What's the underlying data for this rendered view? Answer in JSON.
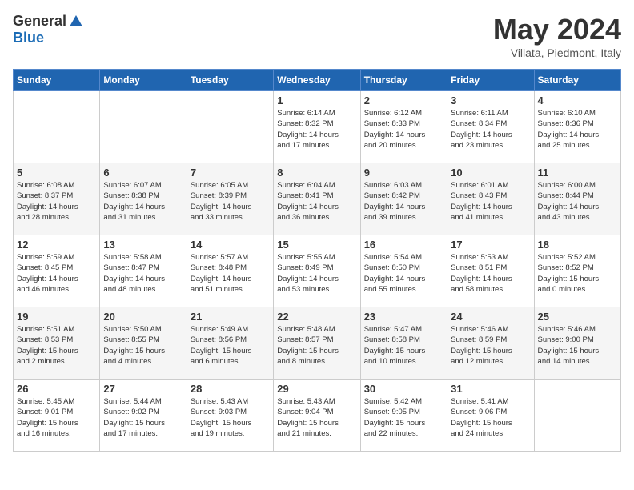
{
  "header": {
    "logo_general": "General",
    "logo_blue": "Blue",
    "month_title": "May 2024",
    "location": "Villata, Piedmont, Italy"
  },
  "weekdays": [
    "Sunday",
    "Monday",
    "Tuesday",
    "Wednesday",
    "Thursday",
    "Friday",
    "Saturday"
  ],
  "weeks": [
    [
      {
        "day": "",
        "info": ""
      },
      {
        "day": "",
        "info": ""
      },
      {
        "day": "",
        "info": ""
      },
      {
        "day": "1",
        "info": "Sunrise: 6:14 AM\nSunset: 8:32 PM\nDaylight: 14 hours\nand 17 minutes."
      },
      {
        "day": "2",
        "info": "Sunrise: 6:12 AM\nSunset: 8:33 PM\nDaylight: 14 hours\nand 20 minutes."
      },
      {
        "day": "3",
        "info": "Sunrise: 6:11 AM\nSunset: 8:34 PM\nDaylight: 14 hours\nand 23 minutes."
      },
      {
        "day": "4",
        "info": "Sunrise: 6:10 AM\nSunset: 8:36 PM\nDaylight: 14 hours\nand 25 minutes."
      }
    ],
    [
      {
        "day": "5",
        "info": "Sunrise: 6:08 AM\nSunset: 8:37 PM\nDaylight: 14 hours\nand 28 minutes."
      },
      {
        "day": "6",
        "info": "Sunrise: 6:07 AM\nSunset: 8:38 PM\nDaylight: 14 hours\nand 31 minutes."
      },
      {
        "day": "7",
        "info": "Sunrise: 6:05 AM\nSunset: 8:39 PM\nDaylight: 14 hours\nand 33 minutes."
      },
      {
        "day": "8",
        "info": "Sunrise: 6:04 AM\nSunset: 8:41 PM\nDaylight: 14 hours\nand 36 minutes."
      },
      {
        "day": "9",
        "info": "Sunrise: 6:03 AM\nSunset: 8:42 PM\nDaylight: 14 hours\nand 39 minutes."
      },
      {
        "day": "10",
        "info": "Sunrise: 6:01 AM\nSunset: 8:43 PM\nDaylight: 14 hours\nand 41 minutes."
      },
      {
        "day": "11",
        "info": "Sunrise: 6:00 AM\nSunset: 8:44 PM\nDaylight: 14 hours\nand 43 minutes."
      }
    ],
    [
      {
        "day": "12",
        "info": "Sunrise: 5:59 AM\nSunset: 8:45 PM\nDaylight: 14 hours\nand 46 minutes."
      },
      {
        "day": "13",
        "info": "Sunrise: 5:58 AM\nSunset: 8:47 PM\nDaylight: 14 hours\nand 48 minutes."
      },
      {
        "day": "14",
        "info": "Sunrise: 5:57 AM\nSunset: 8:48 PM\nDaylight: 14 hours\nand 51 minutes."
      },
      {
        "day": "15",
        "info": "Sunrise: 5:55 AM\nSunset: 8:49 PM\nDaylight: 14 hours\nand 53 minutes."
      },
      {
        "day": "16",
        "info": "Sunrise: 5:54 AM\nSunset: 8:50 PM\nDaylight: 14 hours\nand 55 minutes."
      },
      {
        "day": "17",
        "info": "Sunrise: 5:53 AM\nSunset: 8:51 PM\nDaylight: 14 hours\nand 58 minutes."
      },
      {
        "day": "18",
        "info": "Sunrise: 5:52 AM\nSunset: 8:52 PM\nDaylight: 15 hours\nand 0 minutes."
      }
    ],
    [
      {
        "day": "19",
        "info": "Sunrise: 5:51 AM\nSunset: 8:53 PM\nDaylight: 15 hours\nand 2 minutes."
      },
      {
        "day": "20",
        "info": "Sunrise: 5:50 AM\nSunset: 8:55 PM\nDaylight: 15 hours\nand 4 minutes."
      },
      {
        "day": "21",
        "info": "Sunrise: 5:49 AM\nSunset: 8:56 PM\nDaylight: 15 hours\nand 6 minutes."
      },
      {
        "day": "22",
        "info": "Sunrise: 5:48 AM\nSunset: 8:57 PM\nDaylight: 15 hours\nand 8 minutes."
      },
      {
        "day": "23",
        "info": "Sunrise: 5:47 AM\nSunset: 8:58 PM\nDaylight: 15 hours\nand 10 minutes."
      },
      {
        "day": "24",
        "info": "Sunrise: 5:46 AM\nSunset: 8:59 PM\nDaylight: 15 hours\nand 12 minutes."
      },
      {
        "day": "25",
        "info": "Sunrise: 5:46 AM\nSunset: 9:00 PM\nDaylight: 15 hours\nand 14 minutes."
      }
    ],
    [
      {
        "day": "26",
        "info": "Sunrise: 5:45 AM\nSunset: 9:01 PM\nDaylight: 15 hours\nand 16 minutes."
      },
      {
        "day": "27",
        "info": "Sunrise: 5:44 AM\nSunset: 9:02 PM\nDaylight: 15 hours\nand 17 minutes."
      },
      {
        "day": "28",
        "info": "Sunrise: 5:43 AM\nSunset: 9:03 PM\nDaylight: 15 hours\nand 19 minutes."
      },
      {
        "day": "29",
        "info": "Sunrise: 5:43 AM\nSunset: 9:04 PM\nDaylight: 15 hours\nand 21 minutes."
      },
      {
        "day": "30",
        "info": "Sunrise: 5:42 AM\nSunset: 9:05 PM\nDaylight: 15 hours\nand 22 minutes."
      },
      {
        "day": "31",
        "info": "Sunrise: 5:41 AM\nSunset: 9:06 PM\nDaylight: 15 hours\nand 24 minutes."
      },
      {
        "day": "",
        "info": ""
      }
    ]
  ]
}
